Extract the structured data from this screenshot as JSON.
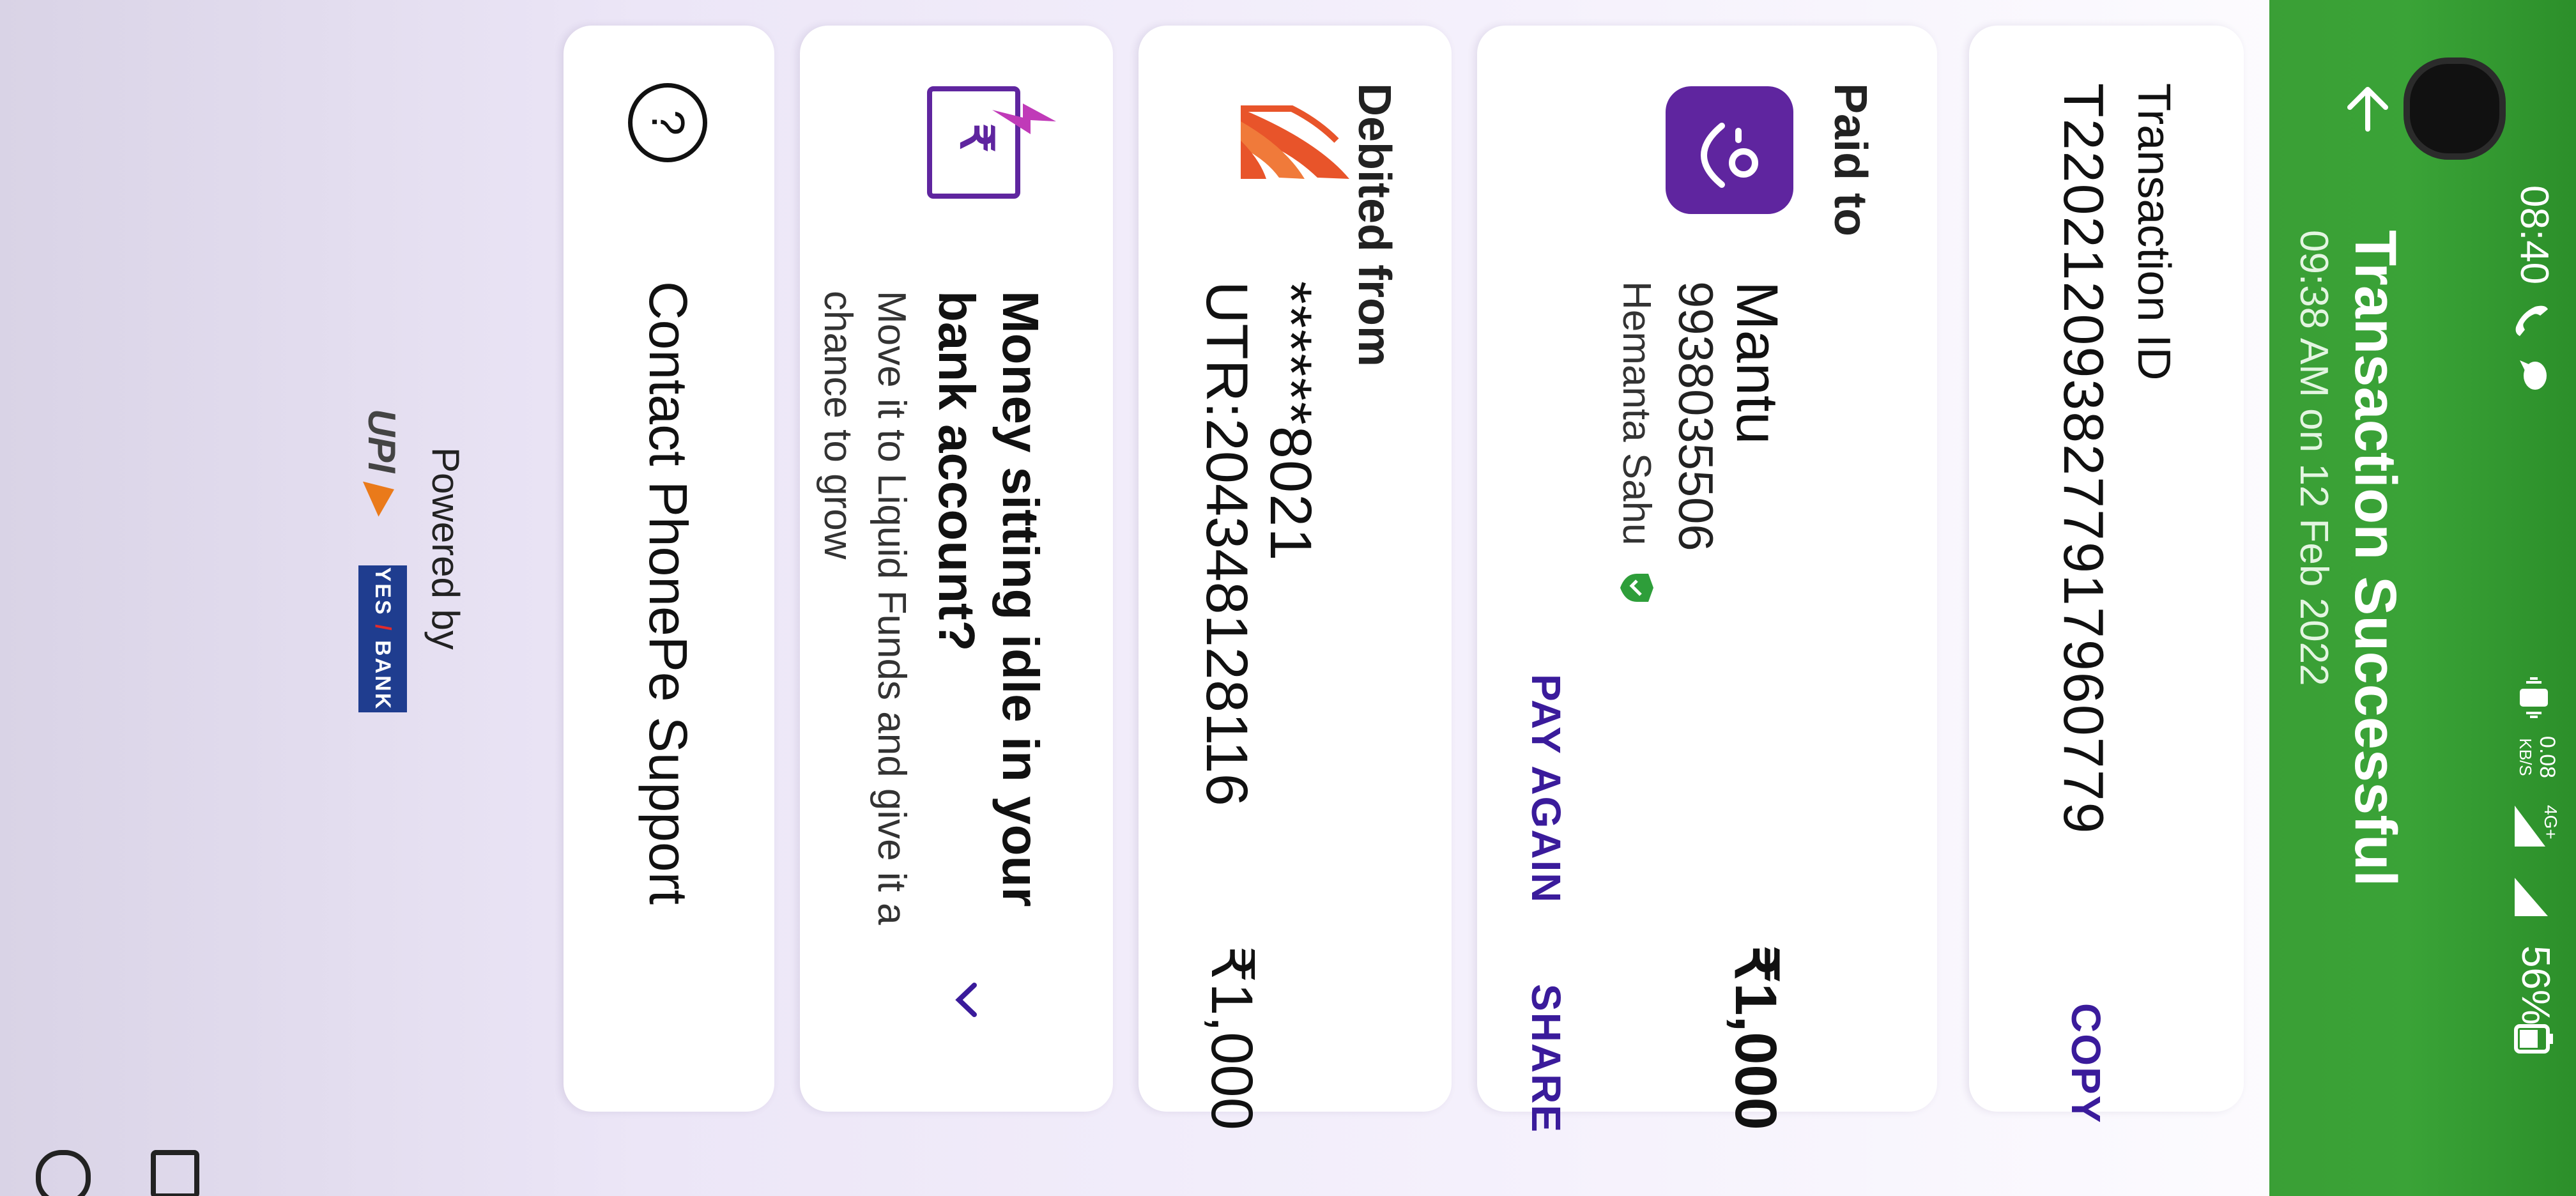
{
  "status_bar": {
    "time": "08:40",
    "network_speed_value": "0.08",
    "network_speed_unit": "KB/S",
    "network_type": "4G+",
    "battery": "56%"
  },
  "header": {
    "title": "Transaction Successful",
    "subtitle": "09:38 AM on 12 Feb 2022"
  },
  "transaction": {
    "label": "Transaction ID",
    "id": "T2202120938277917960779",
    "copy_label": "COPY"
  },
  "paid_to": {
    "label": "Paid to",
    "name": "Mantu",
    "amount": "₹1,000",
    "phone": "9938035506",
    "account_name": "Hemanta  Sahu",
    "pay_again_label": "PAY AGAIN",
    "share_label": "SHARE"
  },
  "debited_from": {
    "label": "Debited from",
    "account": "******8021",
    "amount": "₹1,000",
    "utr": "UTR:204348128116"
  },
  "promo": {
    "title": "Money sitting idle in your bank account?",
    "body": "Move it to Liquid Funds and give it a chance to grow",
    "icon_glyph": "₹"
  },
  "support": {
    "label": "Contact PhonePe Support",
    "icon_glyph": "?"
  },
  "footer": {
    "powered_by": "Powered by",
    "upi_text": "UPI",
    "bank_yes": "YES",
    "bank_bank": "BANK"
  },
  "colors": {
    "header_green": "#3aa337",
    "brand_purple": "#5f259f",
    "action_purple": "#3a1b9b",
    "verified_green": "#2e9e3a",
    "bank_orange": "#e8542a"
  }
}
